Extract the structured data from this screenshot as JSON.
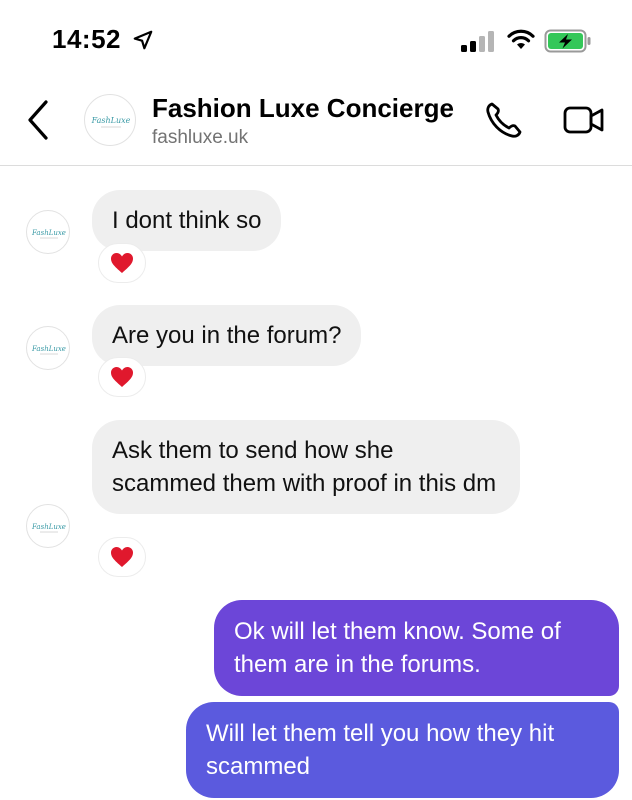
{
  "status_bar": {
    "time": "14:52"
  },
  "header": {
    "title": "Fashion Luxe Concierge",
    "subtitle": "fashluxe.uk",
    "logo_text": "FashLuxe"
  },
  "messages": [
    {
      "sender": "them",
      "text": "I dont think so",
      "reaction": "heart"
    },
    {
      "sender": "them",
      "text": "Are you in the forum?",
      "reaction": "heart"
    },
    {
      "sender": "them",
      "text": "Ask them to send how she scammed them with proof in this dm",
      "reaction": "heart"
    },
    {
      "sender": "me",
      "text": "Ok will let them know. Some of them are in the forums."
    },
    {
      "sender": "me",
      "text": "Will let them tell you how they hit scammed"
    }
  ],
  "colors": {
    "incoming_bubble": "#efefef",
    "outgoing_top": "#6e44d8",
    "outgoing_bottom": "#5b5adf",
    "previous_bubble": "#8a35d0",
    "reaction_heart": "#e0182d",
    "battery_fill": "#34c759"
  },
  "icons": [
    "location-arrow-icon",
    "signal-icon",
    "wifi-icon",
    "battery-charging-icon",
    "back-chevron-icon",
    "phone-icon",
    "video-camera-icon",
    "heart-icon"
  ]
}
